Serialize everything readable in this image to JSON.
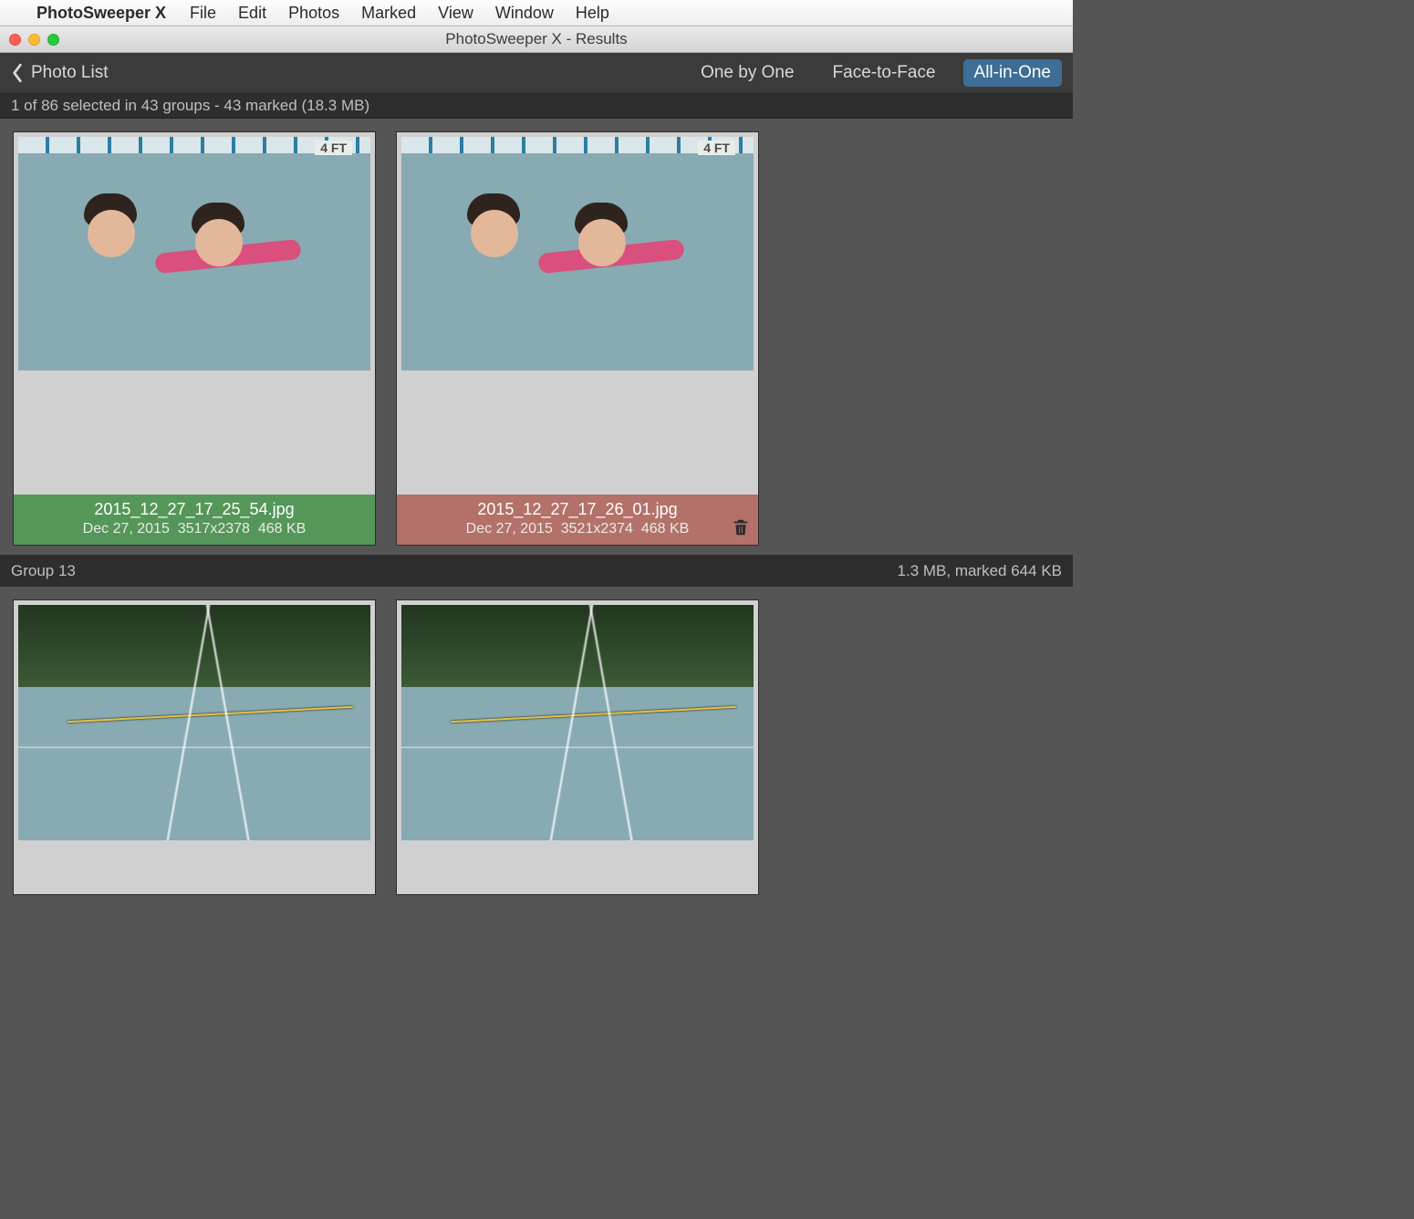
{
  "menubar": {
    "app_name": "PhotoSweeper X",
    "items": [
      "File",
      "Edit",
      "Photos",
      "Marked",
      "View",
      "Window",
      "Help"
    ]
  },
  "titlebar": {
    "title": "PhotoSweeper X - Results"
  },
  "toolbar": {
    "back_label": "Photo List",
    "views": {
      "one_by_one": "One by One",
      "face_to_face": "Face-to-Face",
      "all_in_one": "All-in-One"
    }
  },
  "statusbar": {
    "summary": "1 of 86 selected in 43 groups - 43 marked (18.3 MB)"
  },
  "group12": {
    "photos": [
      {
        "filename": "2015_12_27_17_25_54.jpg",
        "date": "Dec 27, 2015",
        "dimensions": "3517x2378",
        "size": "468 KB",
        "status": "kept",
        "depth_label": "4 FT"
      },
      {
        "filename": "2015_12_27_17_26_01.jpg",
        "date": "Dec 27, 2015",
        "dimensions": "3521x2374",
        "size": "468 KB",
        "status": "marked",
        "depth_label": "4 FT"
      }
    ]
  },
  "group13": {
    "header_left": "Group 13",
    "header_right": "1.3 MB, marked 644 KB"
  }
}
